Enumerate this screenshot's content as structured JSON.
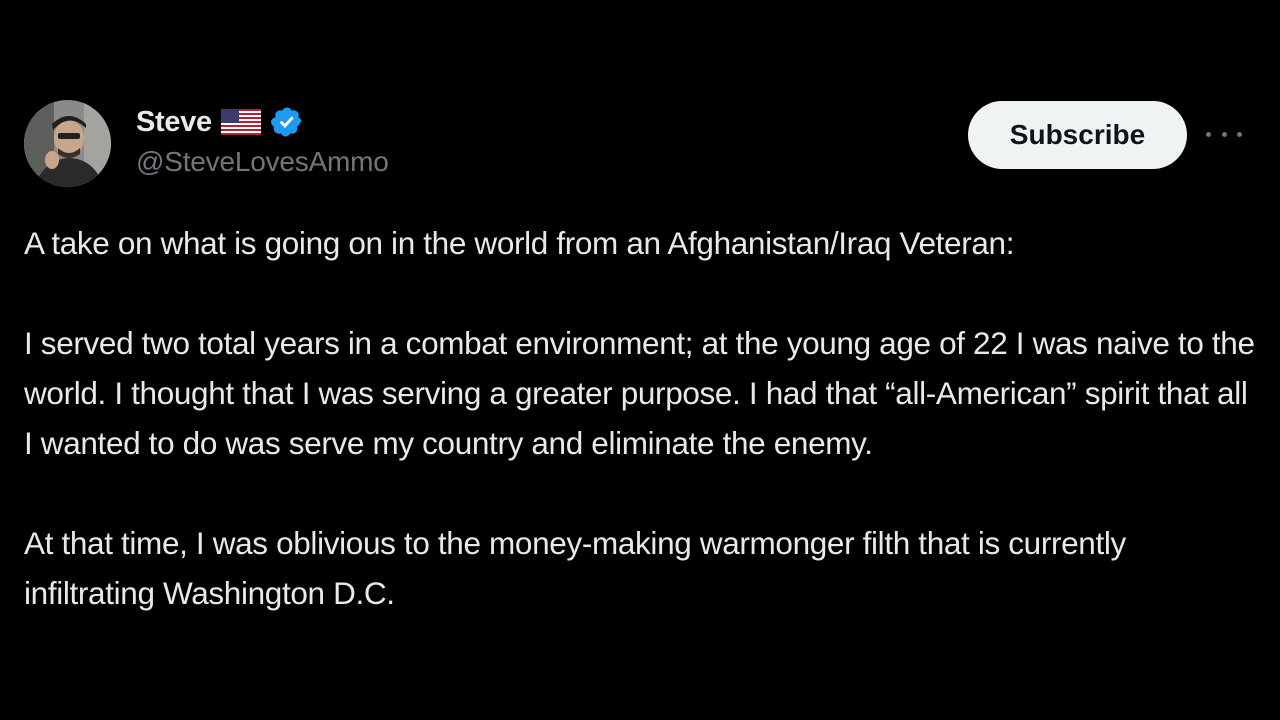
{
  "author": {
    "name": "Steve",
    "handle": "@SteveLovesAmmo",
    "flag_icon": "us-flag-icon",
    "verified_icon": "verified-badge-icon",
    "verified_color": "#1d9bf0"
  },
  "actions": {
    "subscribe_label": "Subscribe",
    "more_icon": "more-horizontal-icon"
  },
  "tweet": {
    "paragraphs": [
      "A take on what is going on in the world from an Afghanistan/Iraq Veteran:",
      "I served two total years in a combat environment; at the young age of 22 I was naive to the world. I thought that I was serving a greater purpose. I had that “all-American” spirit that all I wanted to do was serve my country and eliminate the enemy.",
      "At that time, I was oblivious to the money-making warmonger filth that is currently infiltrating Washington D.C."
    ]
  },
  "colors": {
    "background": "#000000",
    "text_primary": "#e7e9ea",
    "text_secondary": "#71767b",
    "button_bg": "#eff3f4",
    "button_text": "#0f1419"
  }
}
